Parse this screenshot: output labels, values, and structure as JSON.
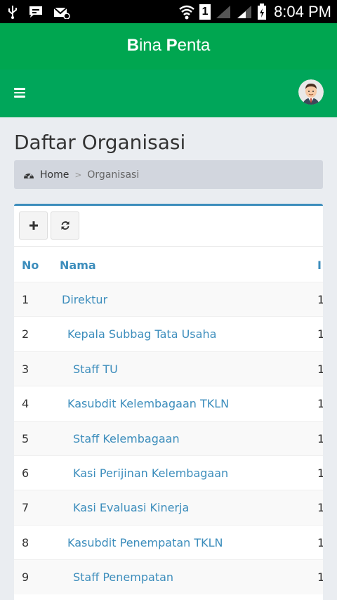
{
  "status_bar": {
    "time": "8:04 PM",
    "sim_number": "1",
    "icons": [
      "usb-icon",
      "message-icon",
      "voicemail-icon",
      "wifi-icon",
      "sim-icon",
      "signal-icon",
      "signal-icon",
      "battery-icon"
    ]
  },
  "app": {
    "title_b1": "B",
    "title_r1": "ina ",
    "title_b2": "P",
    "title_r2": "enta"
  },
  "breadcrumb": {
    "home": "Home",
    "separator": ">",
    "current": "Organisasi"
  },
  "page": {
    "title": "Daftar Organisasi"
  },
  "toolbar": {
    "add_icon": "plus-icon",
    "refresh_icon": "refresh-icon"
  },
  "table": {
    "columns": [
      "No",
      "Nama",
      "I"
    ],
    "rows": [
      {
        "no": "1",
        "name": "Direktur",
        "level": 0,
        "cut": "1"
      },
      {
        "no": "2",
        "name": "Kepala Subbag Tata Usaha",
        "level": 1,
        "cut": "1"
      },
      {
        "no": "3",
        "name": "Staff TU",
        "level": 2,
        "cut": "1"
      },
      {
        "no": "4",
        "name": "Kasubdit Kelembagaan TKLN",
        "level": 1,
        "cut": "1"
      },
      {
        "no": "5",
        "name": "Staff Kelembagaan",
        "level": 2,
        "cut": "1"
      },
      {
        "no": "6",
        "name": "Kasi Perijinan Kelembagaan",
        "level": 2,
        "cut": "1"
      },
      {
        "no": "7",
        "name": "Kasi Evaluasi Kinerja",
        "level": 2,
        "cut": "1"
      },
      {
        "no": "8",
        "name": "Kasubdit Penempatan TKLN",
        "level": 1,
        "cut": "1"
      },
      {
        "no": "9",
        "name": "Staff Penempatan",
        "level": 2,
        "cut": "1"
      }
    ]
  },
  "colors": {
    "header_green": "#00a650",
    "link_blue": "#3c8dbc"
  }
}
